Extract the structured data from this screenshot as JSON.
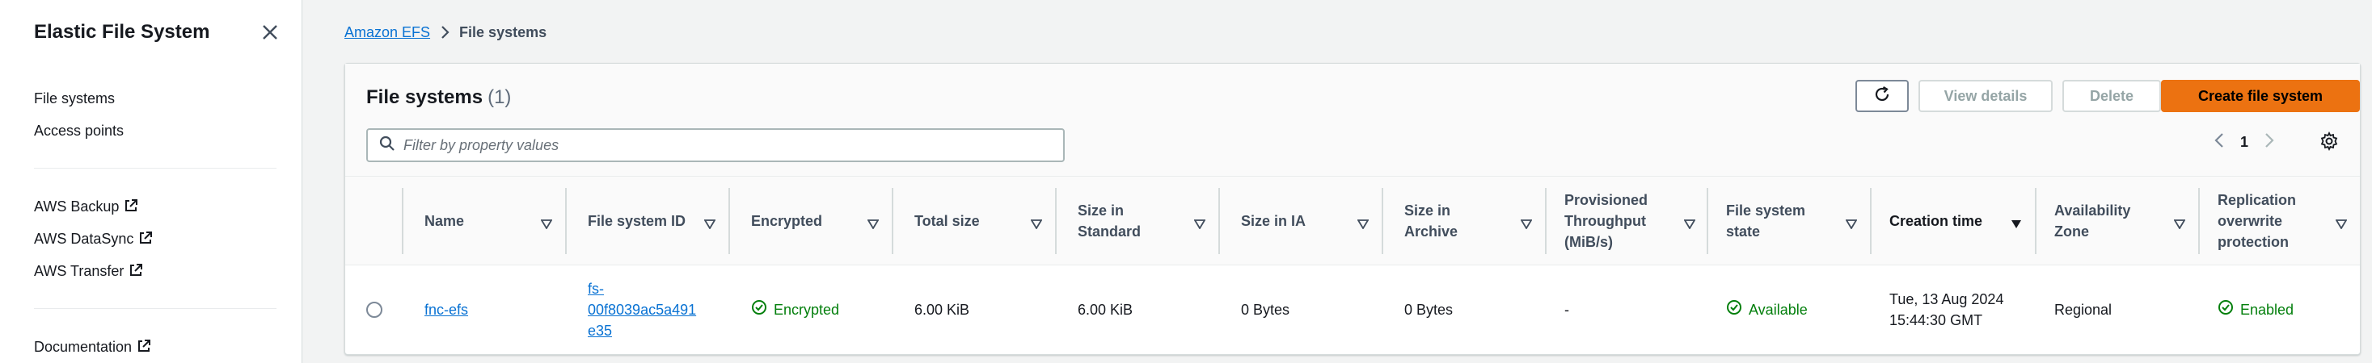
{
  "sidebar": {
    "title": "Elastic File System",
    "nav": [
      "File systems",
      "Access points"
    ],
    "external": [
      "AWS Backup",
      "AWS DataSync",
      "AWS Transfer"
    ],
    "docs": "Documentation"
  },
  "breadcrumb": {
    "root": "Amazon EFS",
    "current": "File systems"
  },
  "panel": {
    "title": "File systems",
    "count": "(1)",
    "buttons": {
      "view_details": "View details",
      "delete": "Delete",
      "create": "Create file system"
    },
    "filter_placeholder": "Filter by property values",
    "page": "1"
  },
  "table": {
    "columns": [
      [
        "Name"
      ],
      [
        "File system ID"
      ],
      [
        "Encrypted"
      ],
      [
        "Total size"
      ],
      [
        "Size in",
        "Standard"
      ],
      [
        "Size in IA"
      ],
      [
        "Size in",
        "Archive"
      ],
      [
        "Provisioned",
        "Throughput",
        "(MiB/s)"
      ],
      [
        "File system",
        "state"
      ],
      [
        "Creation time"
      ],
      [
        "Availability",
        "Zone"
      ],
      [
        "Replication",
        "overwrite",
        "protection"
      ]
    ],
    "row": {
      "name": "fnc-efs",
      "id_lines": [
        "fs-",
        "00f8039ac5a491",
        "e35"
      ],
      "encrypted": "Encrypted",
      "total_size": "6.00 KiB",
      "size_standard": "6.00 KiB",
      "size_ia": "0 Bytes",
      "size_archive": "0 Bytes",
      "throughput": "-",
      "state": "Available",
      "creation_lines": [
        "Tue, 13 Aug 2024",
        "15:44:30 GMT"
      ],
      "az": "Regional",
      "replication": "Enabled"
    }
  },
  "colors": {
    "link": "#0972d3",
    "success": "#037f0c",
    "primary": "#ec7211"
  }
}
